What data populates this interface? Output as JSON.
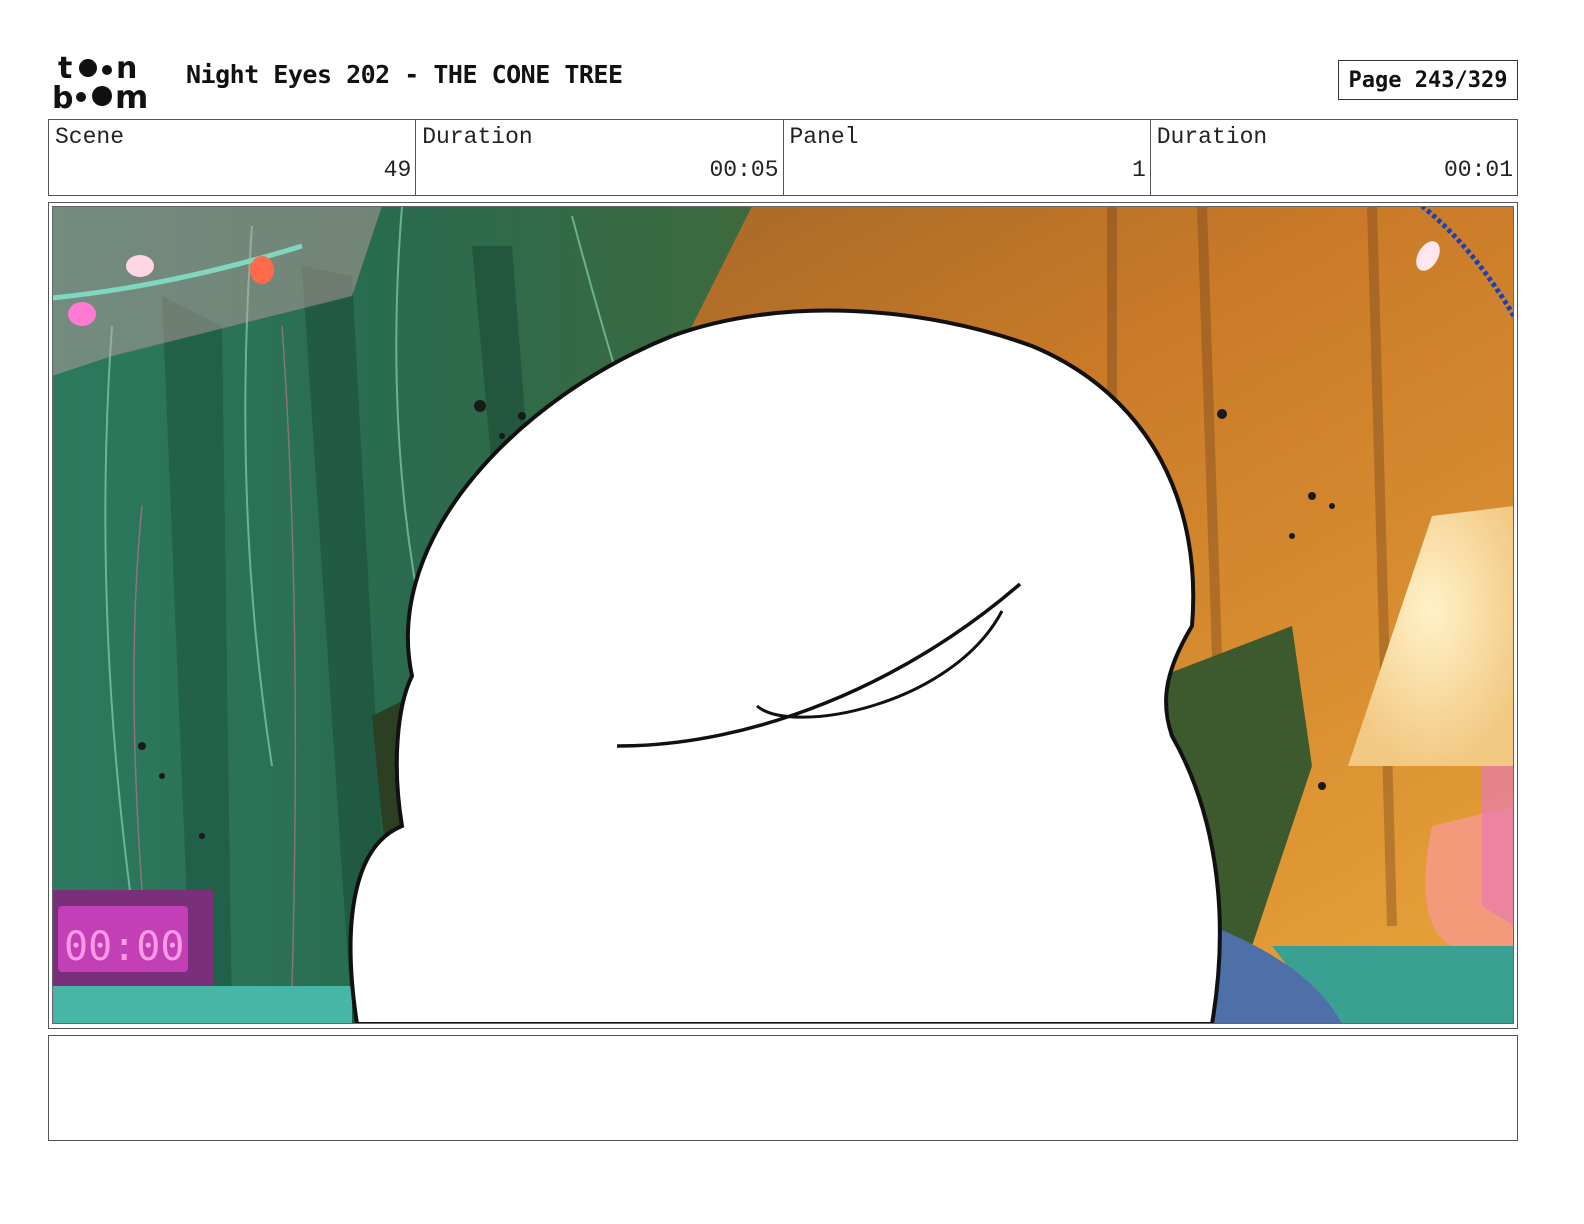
{
  "header": {
    "logo_text": "toon boom",
    "title": "Night Eyes 202 - THE CONE TREE",
    "page": "Page 243/329"
  },
  "info": [
    {
      "label": "Scene",
      "value": "49"
    },
    {
      "label": "Duration",
      "value": "00:05"
    },
    {
      "label": "Panel",
      "value": "1"
    },
    {
      "label": "Duration",
      "value": "00:01"
    }
  ],
  "panel": {
    "clock_display": "00:00"
  },
  "notes": {
    "text": ""
  },
  "colors": {
    "background": "#ffffff",
    "border": "#555555",
    "curtain_green": "#2f7a5c",
    "warm_orange": "#d9862a",
    "clock_magenta": "#c23fb6"
  }
}
